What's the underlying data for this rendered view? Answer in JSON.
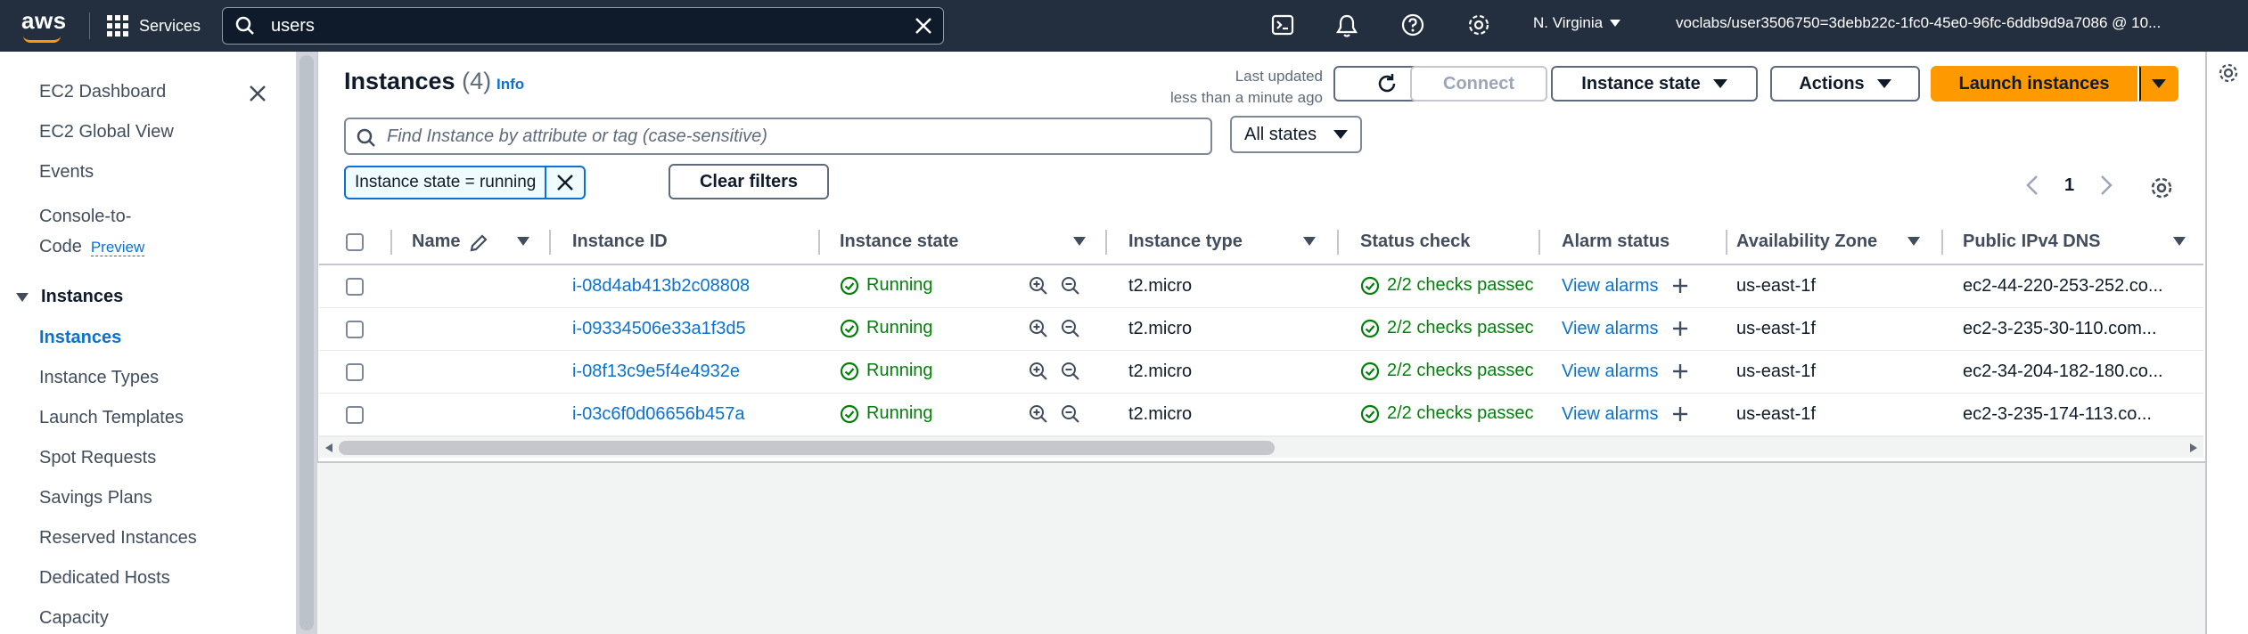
{
  "topbar": {
    "logo": "aws",
    "services_label": "Services",
    "search_value": "users",
    "region_label": "N. Virginia",
    "account_label": "voclabs/user3506750=3debb22c-1fc0-45e0-96fc-6ddb9d9a7086 @ 10..."
  },
  "sidebar": {
    "dashboard": "EC2 Dashboard",
    "global_view": "EC2 Global View",
    "events": "Events",
    "console_line1": "Console-to-",
    "console_line2": "Code",
    "preview": "Preview",
    "section_instances": "Instances",
    "items": [
      "Instances",
      "Instance Types",
      "Launch Templates",
      "Spot Requests",
      "Savings Plans",
      "Reserved Instances",
      "Dedicated Hosts",
      "Capacity"
    ]
  },
  "header": {
    "title": "Instances",
    "count": "(4)",
    "info": "Info",
    "last_updated_line1": "Last updated",
    "last_updated_line2": "less than a minute ago",
    "connect": "Connect",
    "instance_state": "Instance state",
    "actions": "Actions",
    "launch": "Launch instances"
  },
  "filter": {
    "placeholder": "Find Instance by attribute or tag (case-sensitive)",
    "states_select": "All states",
    "token": "Instance state = running",
    "clear": "Clear filters",
    "page": "1"
  },
  "table": {
    "headers": {
      "name": "Name",
      "instance_id": "Instance ID",
      "instance_state": "Instance state",
      "instance_type": "Instance type",
      "status_check": "Status check",
      "alarm_status": "Alarm status",
      "availability_zone": "Availability Zone",
      "public_dns": "Public IPv4 DNS"
    },
    "rows": [
      {
        "id": "i-08d4ab413b2c08808",
        "state": "Running",
        "type": "t2.micro",
        "status": "2/2 checks passec",
        "alarm": "View alarms",
        "az": "us-east-1f",
        "dns": "ec2-44-220-253-252.co..."
      },
      {
        "id": "i-09334506e33a1f3d5",
        "state": "Running",
        "type": "t2.micro",
        "status": "2/2 checks passec",
        "alarm": "View alarms",
        "az": "us-east-1f",
        "dns": "ec2-3-235-30-110.com..."
      },
      {
        "id": "i-08f13c9e5f4e4932e",
        "state": "Running",
        "type": "t2.micro",
        "status": "2/2 checks passec",
        "alarm": "View alarms",
        "az": "us-east-1f",
        "dns": "ec2-34-204-182-180.co..."
      },
      {
        "id": "i-03c6f0d06656b457a",
        "state": "Running",
        "type": "t2.micro",
        "status": "2/2 checks passec",
        "alarm": "View alarms",
        "az": "us-east-1f",
        "dns": "ec2-3-235-174-113.co..."
      }
    ]
  },
  "colors": {
    "topbar": "#232f3e",
    "accent_link": "#0972d3",
    "running_green": "#037f0c",
    "primary_button": "#ff9900"
  }
}
